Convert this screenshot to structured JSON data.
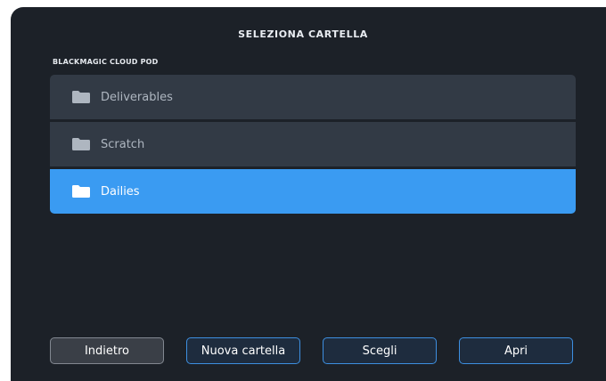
{
  "dialog": {
    "title": "SELEZIONA CARTELLA",
    "location": "BLACKMAGIC CLOUD POD"
  },
  "folders": [
    {
      "label": "Deliverables",
      "icon": "folder-icon",
      "selected": false
    },
    {
      "label": "Scratch",
      "icon": "folder-icon",
      "selected": false
    },
    {
      "label": "Dailies",
      "icon": "folder-icon",
      "selected": true
    }
  ],
  "buttons": {
    "back": "Indietro",
    "new_folder": "Nuova cartella",
    "choose": "Scegli",
    "open": "Apri"
  },
  "colors": {
    "background": "#1c2128",
    "row": "#323a45",
    "selected": "#3a9bf2",
    "button_accent": "#3d8fe0"
  }
}
